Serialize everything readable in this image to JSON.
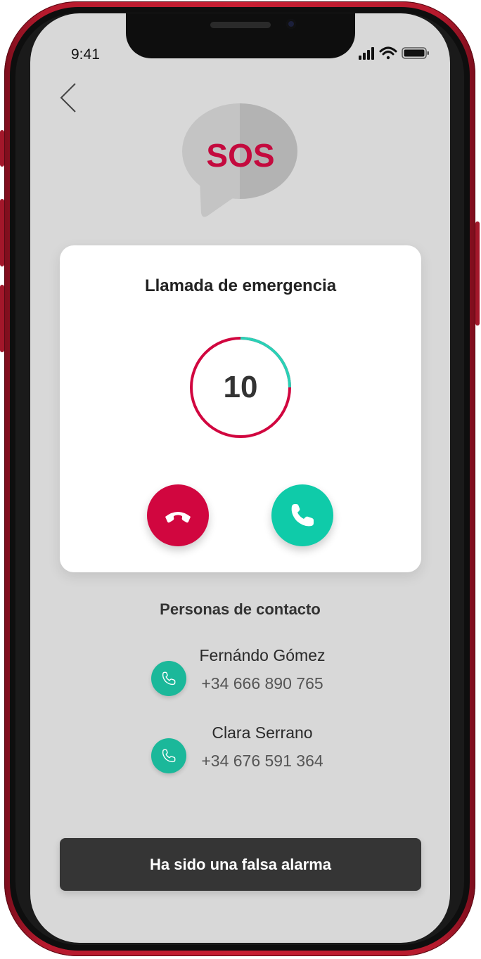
{
  "status_bar": {
    "time": "9:41",
    "icons": [
      "signal-icon",
      "wifi-icon",
      "battery-icon"
    ]
  },
  "header": {
    "back_icon": "chevron-left-icon",
    "logo_text": "SOS"
  },
  "emergency_card": {
    "title": "Llamada de emergencia",
    "countdown": "10",
    "countdown_progress": 0.25,
    "decline_icon": "phone-hangup-icon",
    "accept_icon": "phone-icon"
  },
  "contacts": {
    "title": "Personas de contacto",
    "items": [
      {
        "name": "Fernándo Gómez",
        "phone": "+34 666 890 765",
        "icon": "phone-icon"
      },
      {
        "name": "Clara Serrano",
        "phone": "+34 676 591 364",
        "icon": "phone-icon"
      }
    ]
  },
  "footer": {
    "false_alarm_label": "Ha sido una falsa alarma"
  },
  "colors": {
    "accent_red": "#d1063f",
    "accent_green": "#0fcba9",
    "screen_bg": "#d8d8d8",
    "button_dark": "#353535",
    "frame_red": "#c81f33"
  }
}
